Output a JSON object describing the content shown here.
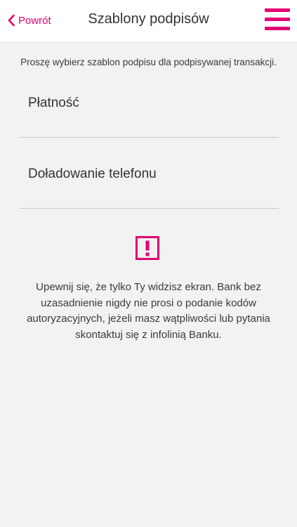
{
  "header": {
    "back_label": "Powrót",
    "title": "Szablony podpisów"
  },
  "instruction": "Proszę wybierz szablon podpisu dla podpisywanej transakcji.",
  "templates": [
    {
      "label": "Płatność"
    },
    {
      "label": "Doładowanie telefonu"
    }
  ],
  "warning": {
    "lines": [
      "Upewnij się, że tylko Ty widzisz ekran. Bank bez",
      "uzasadnienie nigdy nie prosi o podanie kodów",
      "autoryzacyjnych, jeżeli masz wątpliwości lub pytania",
      "skontaktuj się z infolinią Banku."
    ]
  },
  "colors": {
    "accent": "#e20074",
    "background": "#f2f2f2"
  },
  "icons": {
    "back": "chevron-left-icon",
    "menu": "hamburger-menu-icon",
    "warning": "exclamation-square-icon"
  }
}
